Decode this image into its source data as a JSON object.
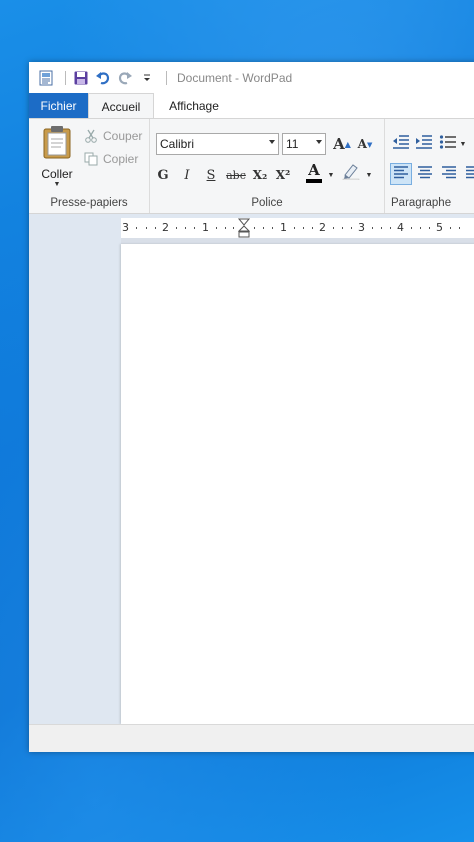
{
  "window": {
    "title": "Document - WordPad"
  },
  "tabs": [
    {
      "label": "Fichier"
    },
    {
      "label": "Accueil"
    },
    {
      "label": "Affichage"
    }
  ],
  "clipboard": {
    "paste_label": "Coller",
    "cut_label": "Couper",
    "copy_label": "Copier",
    "group_label": "Presse-papiers"
  },
  "font": {
    "family": "Calibri",
    "size": "11",
    "group_label": "Police",
    "bold": "G",
    "italic": "I",
    "underline": "S",
    "strike": "abc",
    "subscript": "X₂",
    "superscript": "X²",
    "grow": "A",
    "shrink": "A",
    "color_letter": "A"
  },
  "paragraph": {
    "group_label": "Paragraphe"
  },
  "ruler": {
    "labels": [
      "3",
      "2",
      "1",
      "1",
      "2",
      "3",
      "4",
      "5"
    ]
  },
  "colors": {
    "accent": "#1c6cc6",
    "ribbon_bg": "#f5f6f7",
    "doc_bg": "#dfe7f1",
    "text_color_swatch": "#000000",
    "highlight_swatch": "#ffffff"
  }
}
